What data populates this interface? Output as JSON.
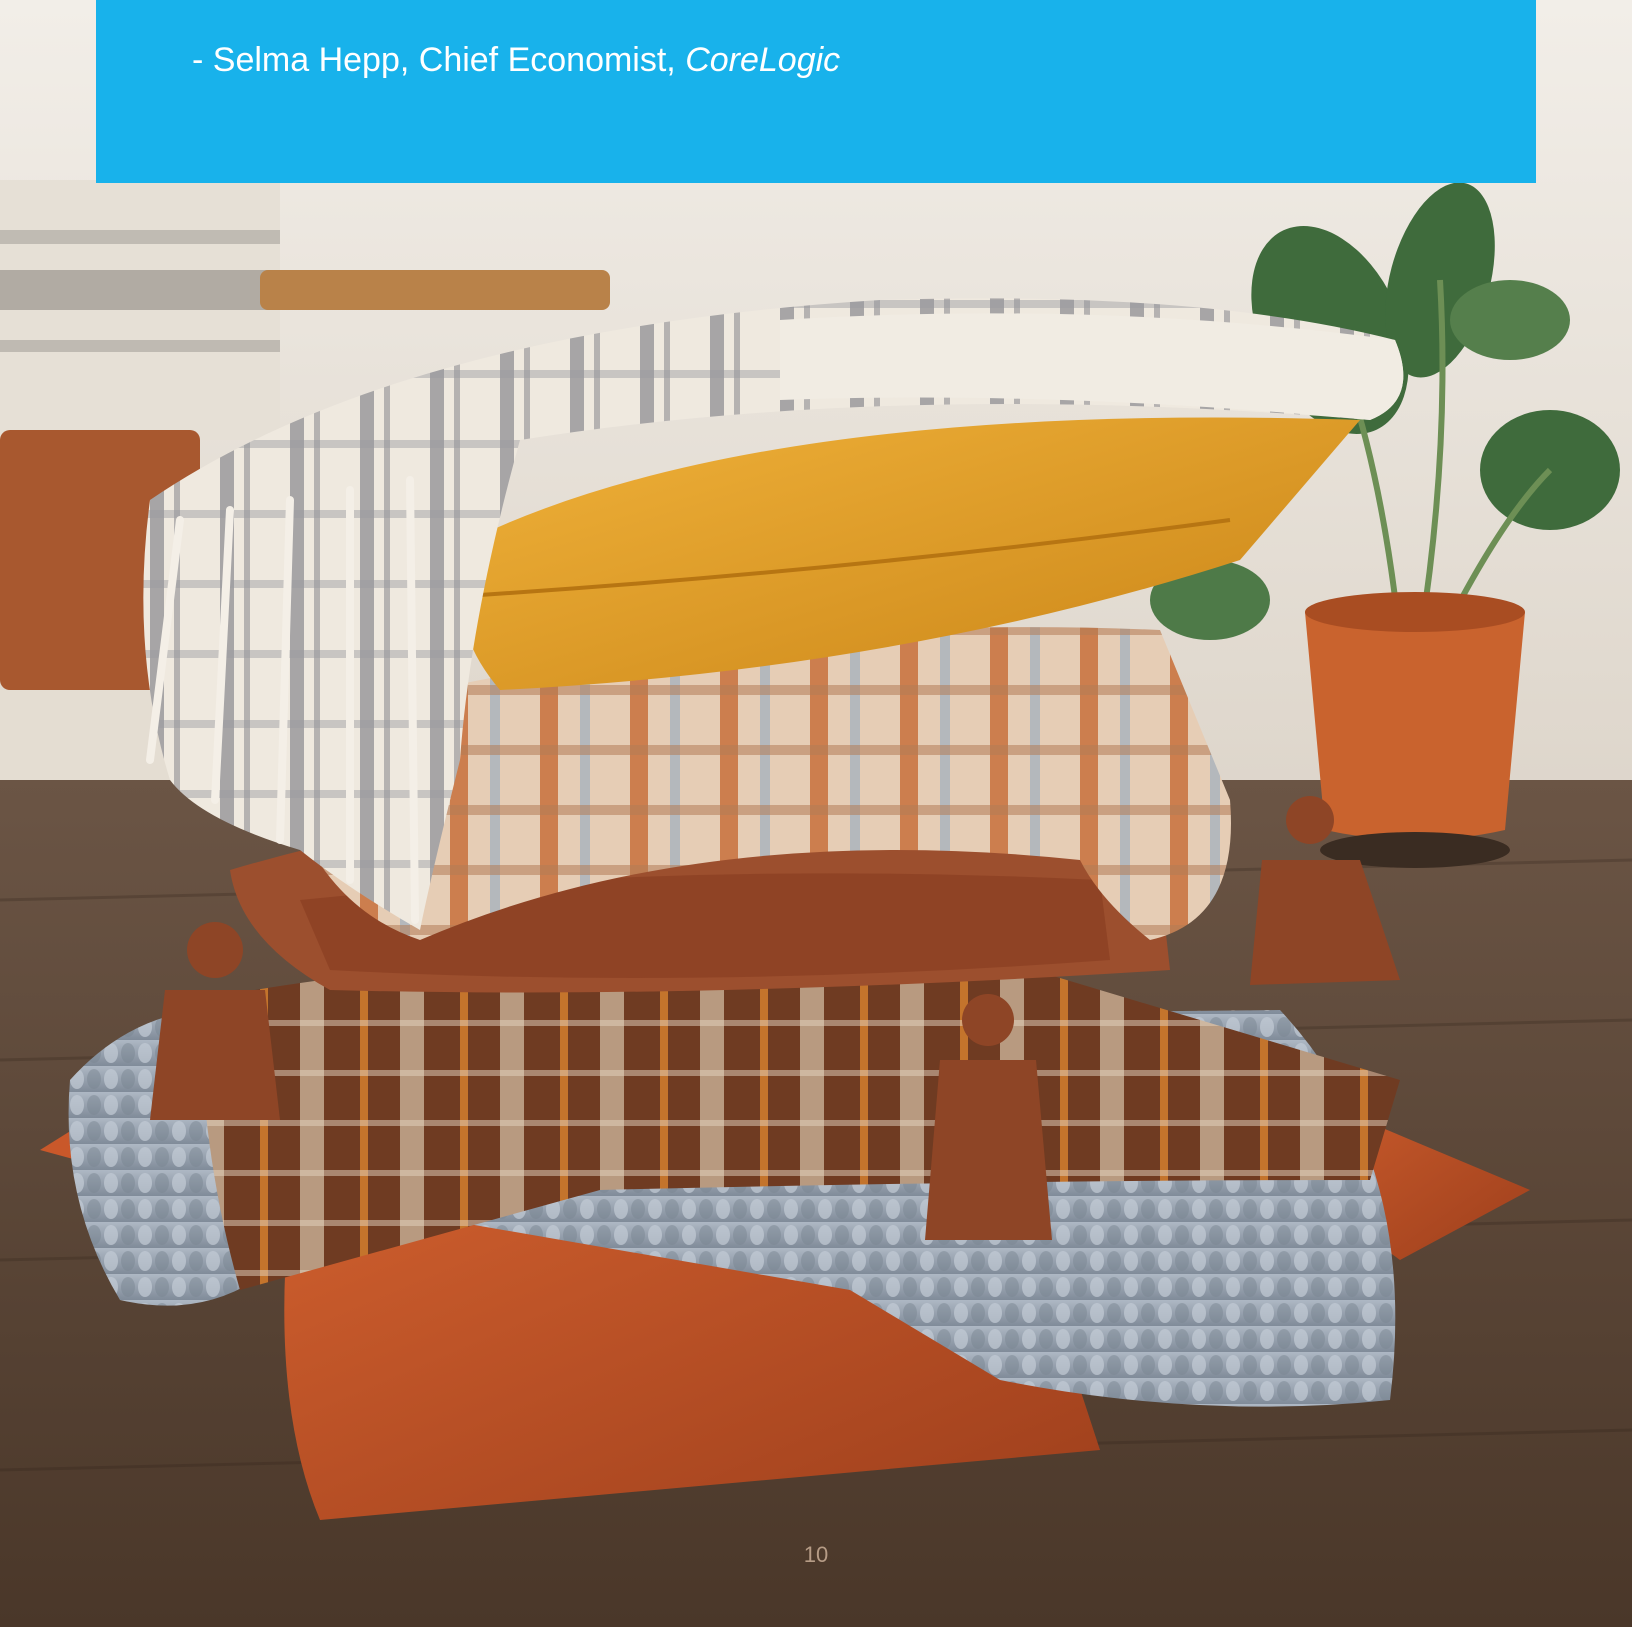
{
  "quote": {
    "attribution_prefix": "- Selma Hepp, Chief Economist, ",
    "attribution_company": "CoreLogic"
  },
  "footer": {
    "page_number": "10"
  },
  "colors": {
    "quote_box": "#18b2eb",
    "wall": "#ece7df",
    "floor": "#5a4636",
    "mustard_pillow": "#e09a25",
    "rust_pillow": "#b94f25",
    "knit_blanket": "#9aa5b3",
    "brown_blanket": "#7d4427",
    "plant_pot": "#c9632e",
    "plant_leaf": "#3f6b3c"
  }
}
